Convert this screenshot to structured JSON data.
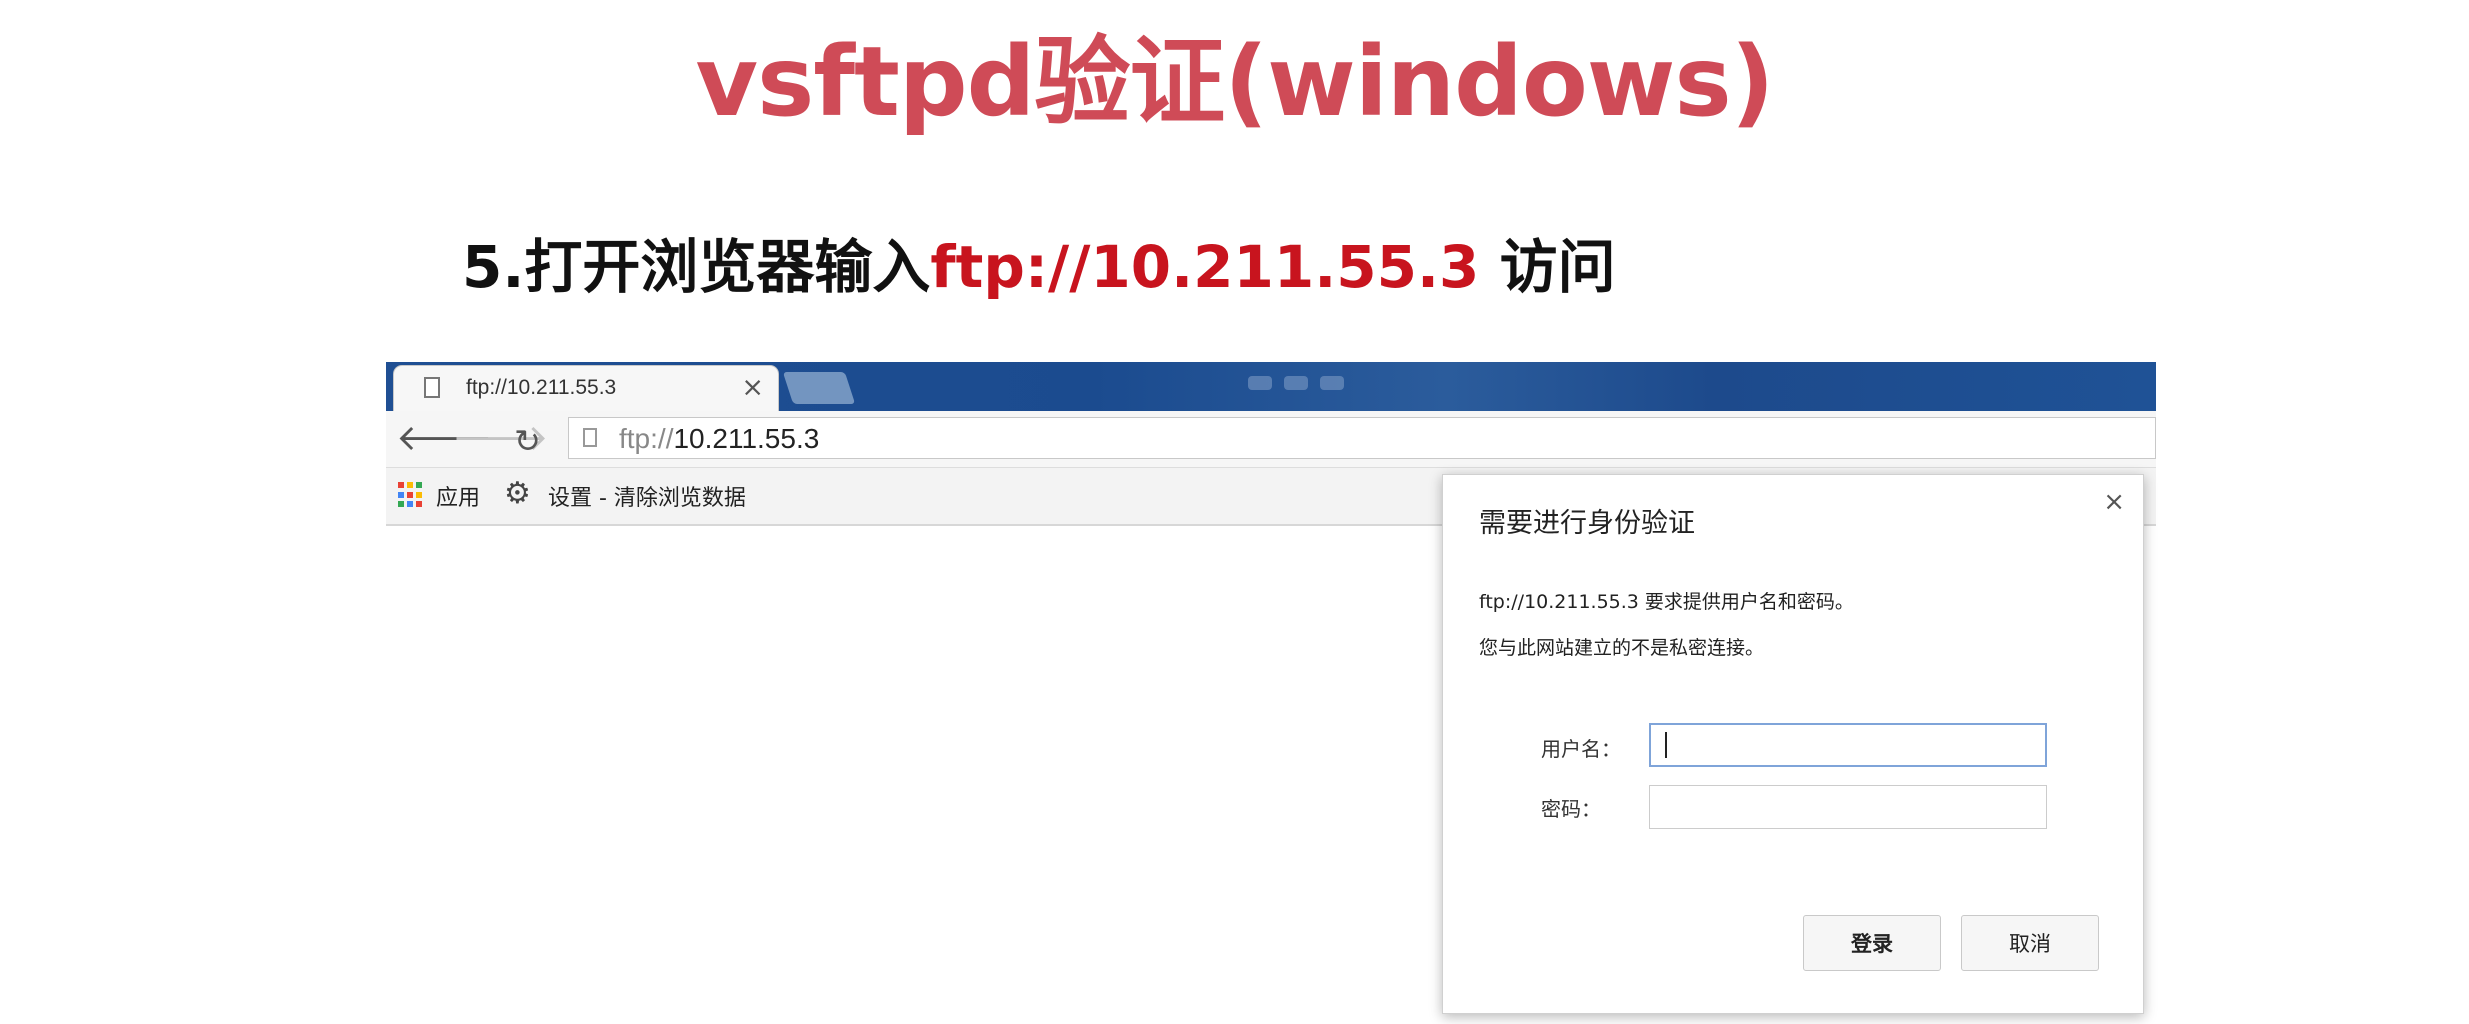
{
  "slide": {
    "title": "vsftpd验证(windows)",
    "step_prefix": "5.打开浏览器输入",
    "step_url": "ftp://10.211.55.3",
    "step_suffix": " 访问"
  },
  "browser": {
    "tab": {
      "title": "ftp://10.211.55.3",
      "close_glyph": "×"
    },
    "toolbar": {
      "back_glyph": "🡐",
      "forward_glyph": "🡒",
      "reload_glyph": "↻",
      "url_scheme": "ftp://",
      "url_host": "10.211.55.3"
    },
    "bookmarks": {
      "apps_label": "应用",
      "settings_label": "设置 - 清除浏览数据",
      "apps_colors": [
        "#e94235",
        "#fbbc05",
        "#34a853",
        "#4285f4",
        "#e94235",
        "#fbbc05",
        "#34a853",
        "#4285f4",
        "#e94235"
      ]
    }
  },
  "dialog": {
    "title": "需要进行身份验证",
    "close_glyph": "×",
    "message_1": "ftp://10.211.55.3 要求提供用户名和密码。",
    "message_2": "您与此网站建立的不是私密连接。",
    "username_label": "用户名：",
    "password_label": "密码：",
    "username_value": "",
    "password_value": "",
    "login_button": "登录",
    "cancel_button": "取消"
  },
  "colors": {
    "title_red": "#cf4b57",
    "url_red": "#c8141e",
    "tabstrip_blue": "#1f4f93"
  }
}
